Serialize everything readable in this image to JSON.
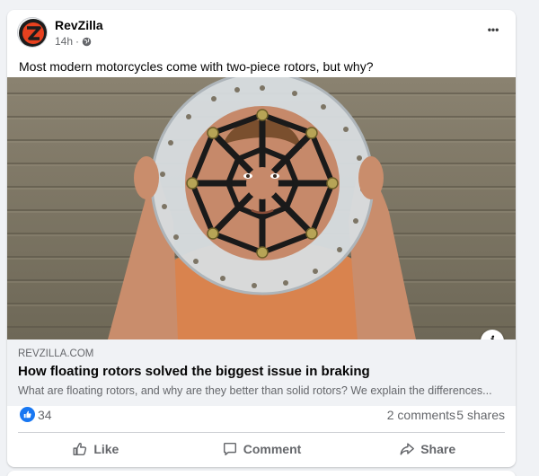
{
  "post": {
    "page_name": "RevZilla",
    "time": "14h",
    "audience_icon": "globe-icon",
    "more_icon": "more-options-icon",
    "more_label": "•••",
    "caption": "Most modern motorcycles come with two-piece rotors, but why?"
  },
  "link": {
    "domain": "REVZILLA.COM",
    "title": "How floating rotors solved the biggest issue in braking",
    "description": "What are floating rotors, and why are they better than solid rotors? We explain the differences...",
    "info_label": "i"
  },
  "stats": {
    "reactions": "34",
    "comments": "2 comments",
    "shares": "5 shares"
  },
  "actions": {
    "like": "Like",
    "comment": "Comment",
    "share": "Share"
  },
  "colors": {
    "brand_red": "#e8411f",
    "facebook_blue": "#1877f2",
    "muted_text": "#65676b"
  }
}
